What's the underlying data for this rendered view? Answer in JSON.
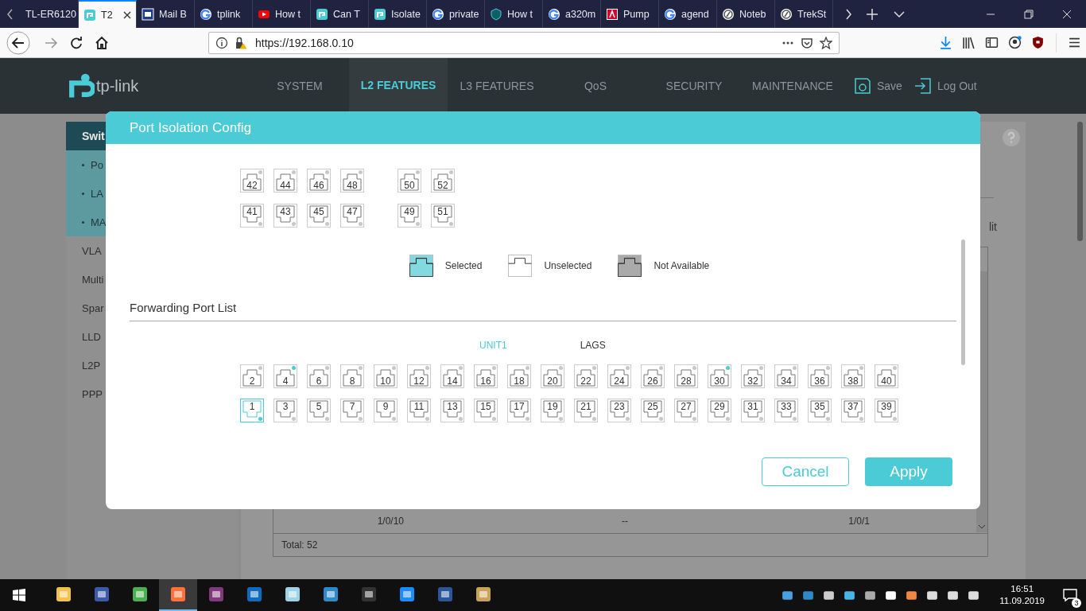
{
  "browser": {
    "tabs": [
      {
        "label": "TL-ER6120",
        "kind": "none",
        "selected": false
      },
      {
        "label": "T2",
        "kind": "tplink",
        "selected": true
      },
      {
        "label": "Mail B",
        "kind": "mail",
        "selected": false
      },
      {
        "label": "tplink",
        "kind": "google",
        "selected": false
      },
      {
        "label": "How t",
        "kind": "youtube",
        "selected": false
      },
      {
        "label": "Can T",
        "kind": "tplink",
        "selected": false
      },
      {
        "label": "Isolate",
        "kind": "tplink",
        "selected": false
      },
      {
        "label": "private",
        "kind": "google",
        "selected": false
      },
      {
        "label": "How t",
        "kind": "shield",
        "selected": false
      },
      {
        "label": "a320m",
        "kind": "google",
        "selected": false
      },
      {
        "label": "Pump",
        "kind": "pdf",
        "selected": false
      },
      {
        "label": "agend",
        "kind": "google",
        "selected": false
      },
      {
        "label": "Noteb",
        "kind": "globe",
        "selected": false
      },
      {
        "label": "TrekSt",
        "kind": "globe",
        "selected": false
      }
    ],
    "url": "https://192.168.0.10"
  },
  "header": {
    "logo": "tp-link",
    "nav": [
      {
        "label": "SYSTEM",
        "selected": false
      },
      {
        "label": "L2 FEATURES",
        "selected": true
      },
      {
        "label": "L3 FEATURES",
        "selected": false
      },
      {
        "label": "QoS",
        "selected": false
      },
      {
        "label": "SECURITY",
        "selected": false
      },
      {
        "label": "MAINTENANCE",
        "selected": false
      }
    ],
    "save": "Save",
    "logout": "Log Out"
  },
  "sidebar": {
    "title": "Swit",
    "subitems": [
      "Po",
      "LA",
      "MA"
    ],
    "items": [
      "VLA",
      "Multi",
      "Spar",
      "LLD",
      "L2P",
      "PPP"
    ]
  },
  "content": {
    "edit_partial": "lit",
    "table_row": [
      "1/0/10",
      "--",
      "1/0/1"
    ],
    "total": "Total: 52"
  },
  "dialog": {
    "title": "Port Isolation Config",
    "upper_ports": {
      "groups": [
        {
          "top": [
            {
              "label": "42",
              "selected": false,
              "linked": false
            },
            {
              "label": "44",
              "selected": false,
              "linked": false
            },
            {
              "label": "46",
              "selected": false,
              "linked": false
            },
            {
              "label": "48",
              "selected": false,
              "linked": false
            }
          ],
          "bottom": [
            {
              "label": "41",
              "selected": false,
              "linked": false
            },
            {
              "label": "43",
              "selected": false,
              "linked": false
            },
            {
              "label": "45",
              "selected": false,
              "linked": false
            },
            {
              "label": "47",
              "selected": false,
              "linked": false
            }
          ]
        },
        {
          "top": [
            {
              "label": "50",
              "selected": false,
              "linked": false
            },
            {
              "label": "52",
              "selected": false,
              "linked": false
            }
          ],
          "bottom": [
            {
              "label": "49",
              "selected": false,
              "linked": false
            },
            {
              "label": "51",
              "selected": false,
              "linked": false
            }
          ]
        }
      ]
    },
    "legend": [
      {
        "kind": "selected",
        "label": "Selected"
      },
      {
        "kind": "unselected",
        "label": "Unselected"
      },
      {
        "kind": "not_available",
        "label": "Not Available"
      }
    ],
    "section_title": "Forwarding Port List",
    "unit_tabs": [
      {
        "label": "UNIT1",
        "selected": true
      },
      {
        "label": "LAGS",
        "selected": false
      }
    ],
    "forwarding_ports": {
      "top": [
        {
          "label": "2",
          "selected": false,
          "linked": false
        },
        {
          "label": "4",
          "selected": false,
          "linked": true
        },
        {
          "label": "6",
          "selected": false,
          "linked": false
        },
        {
          "label": "8",
          "selected": false,
          "linked": false
        },
        {
          "label": "10",
          "selected": false,
          "linked": false
        },
        {
          "label": "12",
          "selected": false,
          "linked": false
        },
        {
          "label": "14",
          "selected": false,
          "linked": false
        },
        {
          "label": "16",
          "selected": false,
          "linked": false
        },
        {
          "label": "18",
          "selected": false,
          "linked": false
        },
        {
          "label": "20",
          "selected": false,
          "linked": false
        },
        {
          "label": "22",
          "selected": false,
          "linked": false
        },
        {
          "label": "24",
          "selected": false,
          "linked": false
        },
        {
          "label": "26",
          "selected": false,
          "linked": false
        },
        {
          "label": "28",
          "selected": false,
          "linked": false
        },
        {
          "label": "30",
          "selected": false,
          "linked": true
        },
        {
          "label": "32",
          "selected": false,
          "linked": false
        },
        {
          "label": "34",
          "selected": false,
          "linked": false
        },
        {
          "label": "36",
          "selected": false,
          "linked": false
        },
        {
          "label": "38",
          "selected": false,
          "linked": false
        },
        {
          "label": "40",
          "selected": false,
          "linked": false
        }
      ],
      "bottom": [
        {
          "label": "1",
          "selected": true,
          "linked": true
        },
        {
          "label": "3",
          "selected": false,
          "linked": false
        },
        {
          "label": "5",
          "selected": false,
          "linked": false
        },
        {
          "label": "7",
          "selected": false,
          "linked": false
        },
        {
          "label": "9",
          "selected": false,
          "linked": false
        },
        {
          "label": "11",
          "selected": false,
          "linked": false
        },
        {
          "label": "13",
          "selected": false,
          "linked": false
        },
        {
          "label": "15",
          "selected": false,
          "linked": false
        },
        {
          "label": "17",
          "selected": false,
          "linked": false
        },
        {
          "label": "19",
          "selected": false,
          "linked": false
        },
        {
          "label": "21",
          "selected": false,
          "linked": false
        },
        {
          "label": "23",
          "selected": false,
          "linked": false
        },
        {
          "label": "25",
          "selected": false,
          "linked": false
        },
        {
          "label": "27",
          "selected": false,
          "linked": false
        },
        {
          "label": "29",
          "selected": false,
          "linked": false
        },
        {
          "label": "31",
          "selected": false,
          "linked": false
        },
        {
          "label": "33",
          "selected": false,
          "linked": false
        },
        {
          "label": "35",
          "selected": false,
          "linked": false
        },
        {
          "label": "37",
          "selected": false,
          "linked": false
        },
        {
          "label": "39",
          "selected": false,
          "linked": false
        }
      ]
    },
    "buttons": {
      "cancel": "Cancel",
      "apply": "Apply"
    }
  },
  "taskbar": {
    "apps": [
      {
        "selected": false
      },
      {
        "selected": false
      },
      {
        "selected": false
      },
      {
        "selected": true
      },
      {
        "selected": false
      },
      {
        "selected": false
      },
      {
        "selected": false
      },
      {
        "selected": false
      },
      {
        "selected": false
      },
      {
        "selected": false
      },
      {
        "selected": false
      },
      {
        "selected": false
      }
    ],
    "time": "16:51",
    "date": "11.09.2019",
    "notifications": "3"
  }
}
